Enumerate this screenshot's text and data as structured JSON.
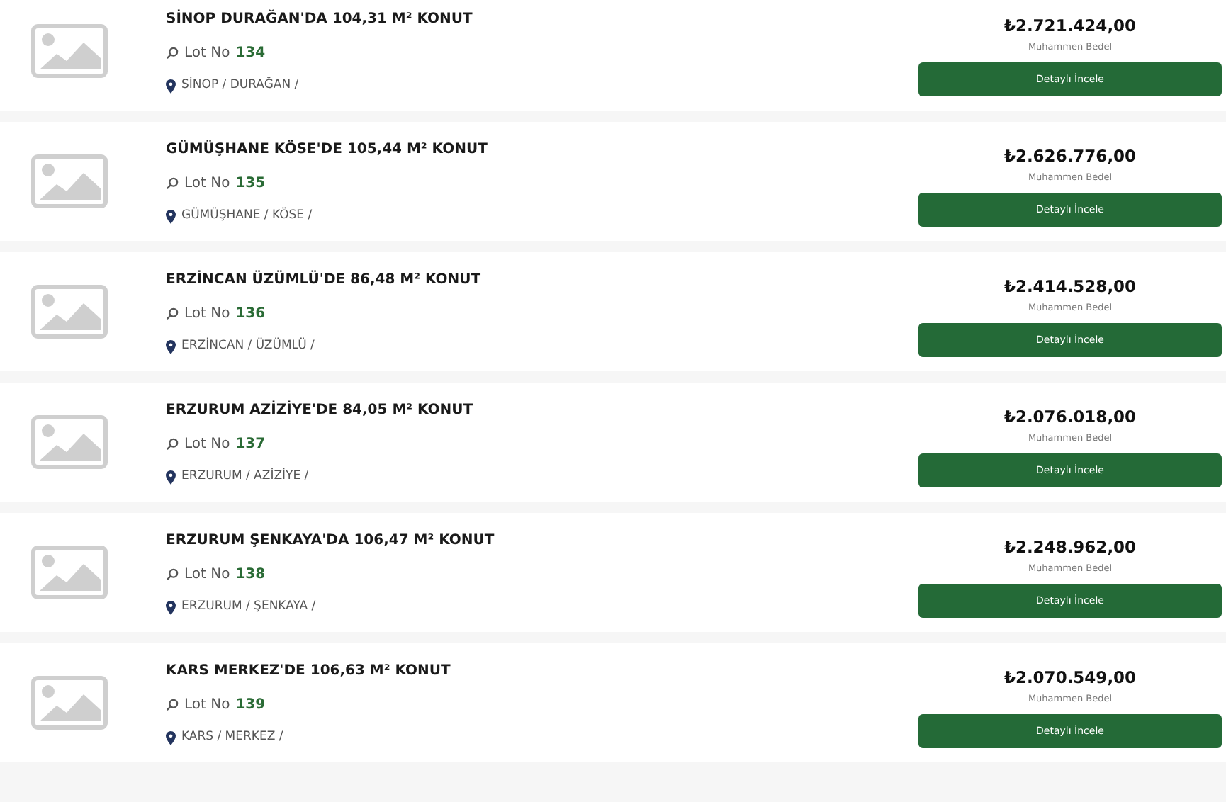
{
  "listings": [
    {
      "title": "SİNOP DURAĞAN'DA 104,31 M² KONUT",
      "lot_label": "Lot No",
      "lot": "134",
      "location": "SİNOP / DURAĞAN /",
      "price": "₺2.721.424,00",
      "price_label": "Muhammen Bedel",
      "button": "Detaylı İncele"
    },
    {
      "title": "GÜMÜŞHANE KÖSE'DE 105,44 M² KONUT",
      "lot_label": "Lot No",
      "lot": "135",
      "location": "GÜMÜŞHANE / KÖSE /",
      "price": "₺2.626.776,00",
      "price_label": "Muhammen Bedel",
      "button": "Detaylı İncele"
    },
    {
      "title": "ERZİNCAN ÜZÜMLÜ'DE 86,48 M² KONUT",
      "lot_label": "Lot No",
      "lot": "136",
      "location": "ERZİNCAN / ÜZÜMLÜ /",
      "price": "₺2.414.528,00",
      "price_label": "Muhammen Bedel",
      "button": "Detaylı İncele"
    },
    {
      "title": "ERZURUM AZİZİYE'DE 84,05 M² KONUT",
      "lot_label": "Lot No",
      "lot": "137",
      "location": "ERZURUM / AZİZİYE /",
      "price": "₺2.076.018,00",
      "price_label": "Muhammen Bedel",
      "button": "Detaylı İncele"
    },
    {
      "title": "ERZURUM ŞENKAYA'DA 106,47 M² KONUT",
      "lot_label": "Lot No",
      "lot": "138",
      "location": "ERZURUM / ŞENKAYA /",
      "price": "₺2.248.962,00",
      "price_label": "Muhammen Bedel",
      "button": "Detaylı İncele"
    },
    {
      "title": "KARS MERKEZ'DE 106,63 M² KONUT",
      "lot_label": "Lot No",
      "lot": "139",
      "location": "KARS / MERKEZ /",
      "price": "₺2.070.549,00",
      "price_label": "Muhammen Bedel",
      "button": "Detaylı İncele"
    }
  ]
}
